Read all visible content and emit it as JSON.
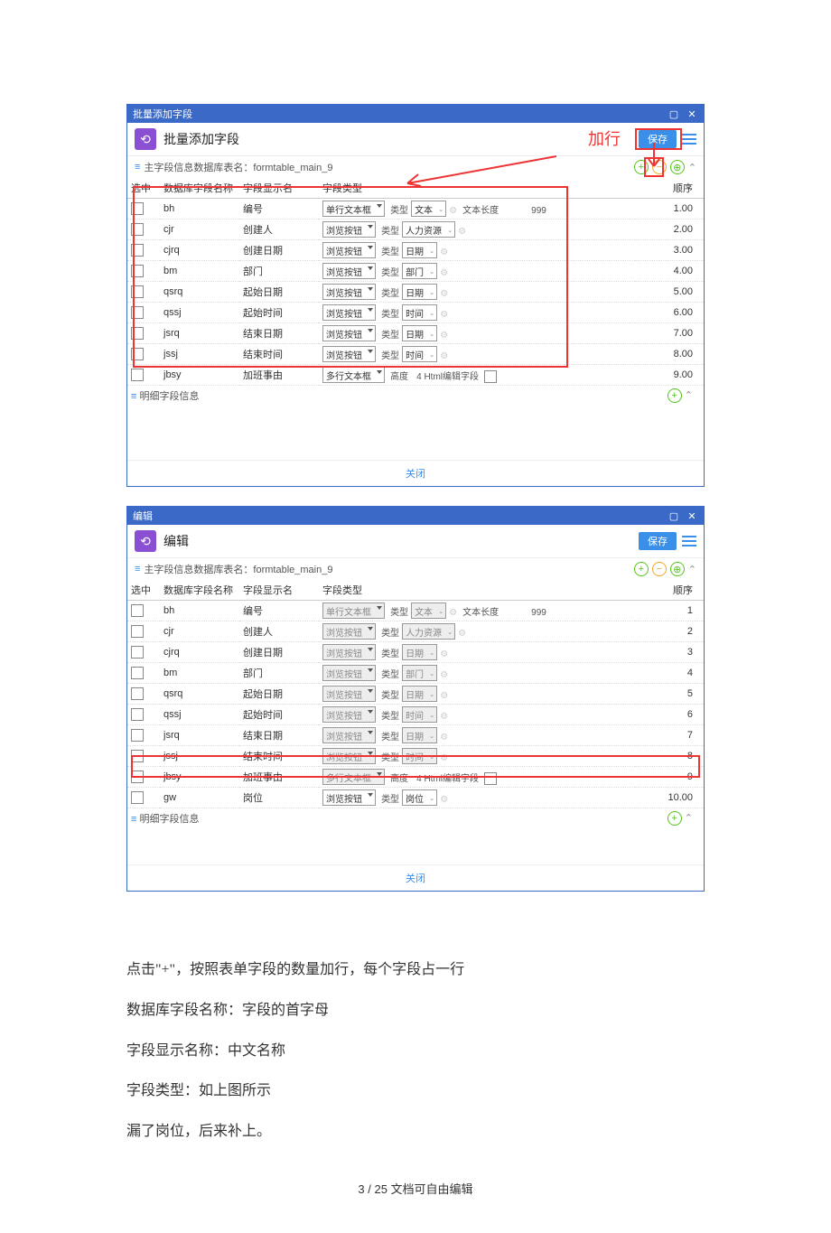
{
  "panel1": {
    "titlebar": "批量添加字段",
    "title": "批量添加字段",
    "save": "保存",
    "db_label": "主字段信息数据库表名：formtable_main_9",
    "headers": {
      "sel": "选中",
      "name": "数据库字段名称",
      "disp": "字段显示名",
      "type": "字段类型",
      "seq": "顺序"
    },
    "rows": [
      {
        "n": "bh",
        "d": "编号",
        "t": "单行文本框",
        "sub": "文本",
        "extra_lbl": "文本长度",
        "extra_val": "999",
        "s": "1.00"
      },
      {
        "n": "cjr",
        "d": "创建人",
        "t": "浏览按钮",
        "sub": "人力资源",
        "s": "2.00"
      },
      {
        "n": "cjrq",
        "d": "创建日期",
        "t": "浏览按钮",
        "sub": "日期",
        "s": "3.00"
      },
      {
        "n": "bm",
        "d": "部门",
        "t": "浏览按钮",
        "sub": "部门",
        "s": "4.00"
      },
      {
        "n": "qsrq",
        "d": "起始日期",
        "t": "浏览按钮",
        "sub": "日期",
        "s": "5.00"
      },
      {
        "n": "qssj",
        "d": "起始时间",
        "t": "浏览按钮",
        "sub": "时间",
        "s": "6.00"
      },
      {
        "n": "jsrq",
        "d": "结束日期",
        "t": "浏览按钮",
        "sub": "日期",
        "s": "7.00"
      },
      {
        "n": "jssj",
        "d": "结束时间",
        "t": "浏览按钮",
        "sub": "时间",
        "s": "8.00"
      },
      {
        "n": "jbsy",
        "d": "加班事由",
        "t": "多行文本框",
        "html": "高度",
        "html2": "4 Html编辑字段",
        "s": "9.00"
      }
    ],
    "detail": "明细字段信息",
    "close": "关闭",
    "annotation": "加行"
  },
  "panel2": {
    "titlebar": "编辑",
    "title": "编辑",
    "save": "保存",
    "db_label": "主字段信息数据库表名：formtable_main_9",
    "headers": {
      "sel": "选中",
      "name": "数据库字段名称",
      "disp": "字段显示名",
      "type": "字段类型",
      "seq": "顺序"
    },
    "rows": [
      {
        "n": "bh",
        "d": "编号",
        "t": "单行文本框",
        "sub": "文本",
        "extra_lbl": "文本长度",
        "extra_val": "999",
        "s": "1",
        "dis": true
      },
      {
        "n": "cjr",
        "d": "创建人",
        "t": "浏览按钮",
        "sub": "人力资源",
        "s": "2",
        "dis": true
      },
      {
        "n": "cjrq",
        "d": "创建日期",
        "t": "浏览按钮",
        "sub": "日期",
        "s": "3",
        "dis": true
      },
      {
        "n": "bm",
        "d": "部门",
        "t": "浏览按钮",
        "sub": "部门",
        "s": "4",
        "dis": true
      },
      {
        "n": "qsrq",
        "d": "起始日期",
        "t": "浏览按钮",
        "sub": "日期",
        "s": "5",
        "dis": true
      },
      {
        "n": "qssj",
        "d": "起始时间",
        "t": "浏览按钮",
        "sub": "时间",
        "s": "6",
        "dis": true
      },
      {
        "n": "jsrq",
        "d": "结束日期",
        "t": "浏览按钮",
        "sub": "日期",
        "s": "7",
        "dis": true
      },
      {
        "n": "jssj",
        "d": "结束时间",
        "t": "浏览按钮",
        "sub": "时间",
        "s": "8",
        "dis": true
      },
      {
        "n": "jbsy",
        "d": "加班事由",
        "t": "多行文本框",
        "html": "高度",
        "html2": "4 Html编辑字段",
        "s": "9",
        "dis": true
      },
      {
        "n": "gw",
        "d": "岗位",
        "t": "浏览按钮",
        "sub": "岗位",
        "s": "10.00",
        "hl": true
      }
    ],
    "detail": "明细字段信息",
    "close": "关闭"
  },
  "body": {
    "l1": "点击\"+\"，按照表单字段的数量加行，每个字段占一行",
    "l2": "数据库字段名称：字段的首字母",
    "l3": "字段显示名称：中文名称",
    "l4": "字段类型：如上图所示",
    "l5": "漏了岗位，后来补上。"
  },
  "footer": "3 / 25 文档可自由编辑",
  "label_type": "类型"
}
